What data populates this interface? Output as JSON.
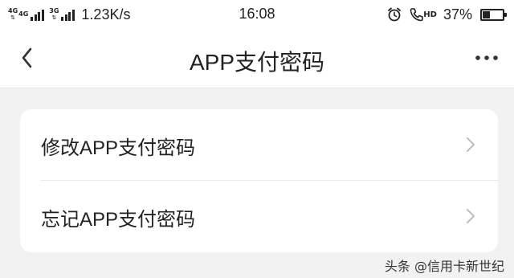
{
  "status_bar": {
    "net1": "4G",
    "net2": "4G",
    "net3": "3G",
    "speed": "1.23K/s",
    "time": "16:08",
    "battery_percent": "37%",
    "battery_level": 0.37,
    "hd": "HD",
    "icons": [
      "alarm-icon",
      "call-icon",
      "battery-icon"
    ]
  },
  "nav": {
    "title": "APP支付密码",
    "back_icon": "chevron-left-icon",
    "more_icon": "more-icon"
  },
  "menu": {
    "items": [
      {
        "label": "修改APP支付密码"
      },
      {
        "label": "忘记APP支付密码"
      }
    ]
  },
  "watermark": "头条 @信用卡新世纪"
}
